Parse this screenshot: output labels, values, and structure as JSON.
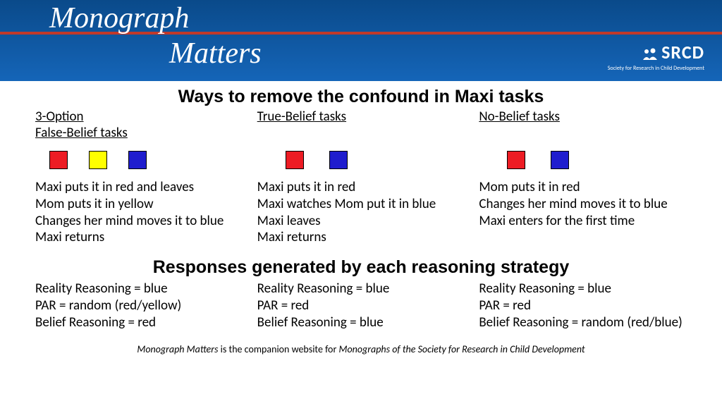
{
  "header": {
    "brand_top": "Monograph",
    "brand_bottom": "Matters",
    "logo_main": "SRCD",
    "logo_sub": "Society for Research in Child Development"
  },
  "title1": "Ways to remove the confound in Maxi tasks",
  "columns": [
    {
      "prefix": "3-Option",
      "title": "False-Belief tasks",
      "squares": [
        "red",
        "yellow",
        "blue"
      ],
      "steps": [
        "Maxi puts it in red and leaves",
        "Mom puts it in yellow",
        "Changes her mind moves it to blue",
        "Maxi returns"
      ],
      "responses": [
        "Reality Reasoning = blue",
        "PAR = random (red/yellow)",
        "Belief Reasoning = red"
      ]
    },
    {
      "prefix": "",
      "title": "True-Belief tasks",
      "squares": [
        "red",
        "blue"
      ],
      "steps": [
        "Maxi puts it in red",
        "Maxi watches Mom put it in blue",
        "Maxi leaves",
        "Maxi returns"
      ],
      "responses": [
        "Reality Reasoning = blue",
        "PAR = red",
        "Belief Reasoning = blue"
      ]
    },
    {
      "prefix": "",
      "title": "No-Belief tasks",
      "squares": [
        "red",
        "blue"
      ],
      "steps": [
        "Mom puts it in red",
        "Changes her mind moves it to blue",
        "Maxi enters for the first time",
        ""
      ],
      "responses": [
        "Reality Reasoning = blue",
        "PAR = red",
        "Belief Reasoning = random (red/blue)"
      ]
    }
  ],
  "title2": "Responses generated by each reasoning strategy",
  "footer": {
    "part1": "Monograph Matters",
    "part2": " is the companion website for ",
    "part3": "Monographs of the Society for Research in Child Development"
  }
}
